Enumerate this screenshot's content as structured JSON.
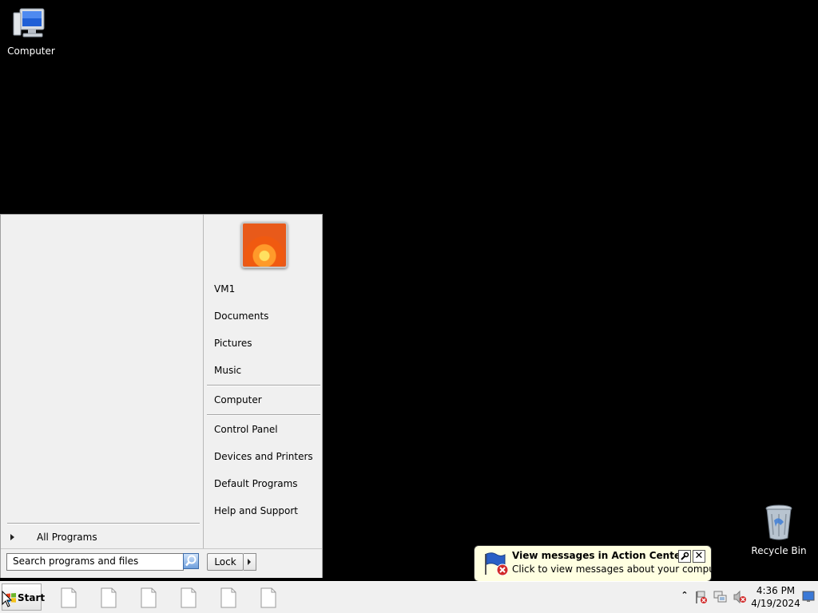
{
  "desktop": {
    "icons": [
      {
        "label": "Computer"
      },
      {
        "label": "Recycle Bin"
      }
    ]
  },
  "start_menu": {
    "all_programs_label": "All Programs",
    "right_items": [
      {
        "label": "VM1"
      },
      {
        "label": "Documents"
      },
      {
        "label": "Pictures"
      },
      {
        "label": "Music"
      },
      {
        "label": "Computer"
      },
      {
        "label": "Control Panel"
      },
      {
        "label": "Devices and Printers"
      },
      {
        "label": "Default Programs"
      },
      {
        "label": "Help and Support"
      }
    ],
    "search_placeholder": "Search programs and files",
    "lock_label": "Lock"
  },
  "balloon": {
    "title": "View messages in Action Center",
    "text": "Click to view messages about your computer."
  },
  "taskbar": {
    "start_label": "Start",
    "clock_time": "4:36 PM",
    "clock_date": "4/19/2024"
  }
}
